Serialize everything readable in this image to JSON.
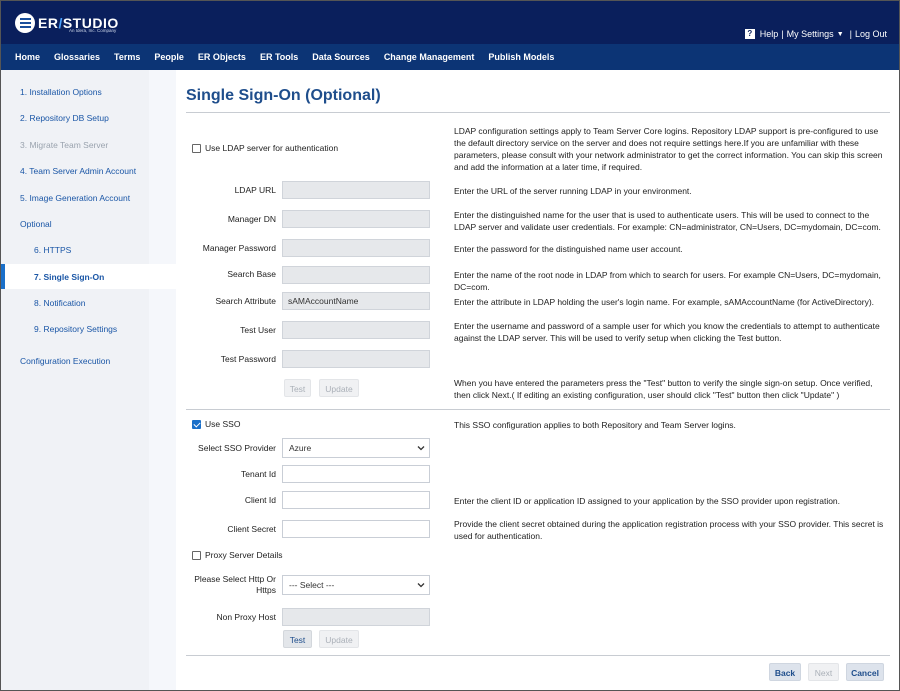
{
  "header": {
    "logo_text": "ER",
    "logo_text2": "STUDIO",
    "logo_sub": "An Idera, Inc. Company",
    "help_icon": "?",
    "help_label": "Help",
    "settings_label": "My Settings",
    "logout_label": "Log Out"
  },
  "nav": [
    "Home",
    "Glossaries",
    "Terms",
    "People",
    "ER Objects",
    "ER Tools",
    "Data Sources",
    "Change Management",
    "Publish Models"
  ],
  "sidebar": {
    "items": [
      {
        "label": "1. Installation Options"
      },
      {
        "label": "2. Repository DB Setup"
      },
      {
        "label": "3. Migrate Team Server"
      },
      {
        "label": "4. Team Server Admin Account"
      },
      {
        "label": "5. Image Generation Account"
      },
      {
        "label": "Optional"
      },
      {
        "label": "6. HTTPS"
      },
      {
        "label": "7. Single Sign-On"
      },
      {
        "label": "8. Notification"
      },
      {
        "label": "9. Repository Settings"
      },
      {
        "label": "Configuration Execution"
      }
    ]
  },
  "page": {
    "title": "Single Sign-On (Optional)"
  },
  "ldap": {
    "use_ldap_label": "Use LDAP server for authentication",
    "intro": "LDAP configuration settings apply to Team Server Core logins. Repository LDAP support is pre-configured to use the default directory service on the server and does not require settings here.If you are unfamiliar with these parameters, please consult with your network administrator to get the correct information. You can skip this screen and add the information at a later time, if required.",
    "fields": {
      "url": {
        "label": "LDAP URL",
        "value": "",
        "desc": "Enter the URL of the server running LDAP in your environment."
      },
      "manager_dn": {
        "label": "Manager DN",
        "value": "",
        "desc": "Enter the distinguished name for the user that is used to authenticate users. This will be used to connect to the LDAP server and validate user credentials. For example: CN=administrator, CN=Users, DC=mydomain, DC=com."
      },
      "manager_password": {
        "label": "Manager Password",
        "value": "",
        "desc": "Enter the password for the distinguished name user account."
      },
      "search_base": {
        "label": "Search Base",
        "value": "",
        "desc": "Enter the name of the root node in LDAP from which to search for users. For example CN=Users, DC=mydomain, DC=com."
      },
      "search_attribute": {
        "label": "Search Attribute",
        "value": "sAMAccountName",
        "desc": "Enter the attribute in LDAP holding the user's login name. For example, sAMAccountName (for ActiveDirectory)."
      },
      "test_user": {
        "label": "Test User",
        "value": "",
        "desc": "Enter the username and password of a sample user for which you know the credentials to attempt to authenticate against the LDAP server. This will be used to verify setup when clicking the Test button."
      },
      "test_password": {
        "label": "Test Password",
        "value": ""
      }
    },
    "test_label": "Test",
    "update_label": "Update",
    "verify_desc": "When you have entered the parameters press the \"Test\" button to verify the single sign-on setup. Once verified, then click Next.( If editing an existing configuration, user should click \"Test\" button then click \"Update\" )"
  },
  "sso": {
    "use_sso_label": "Use SSO",
    "intro": "This SSO configuration applies to both Repository and Team Server logins.",
    "provider_label": "Select SSO Provider",
    "provider_value": "Azure",
    "tenant_label": "Tenant Id",
    "tenant_value": "",
    "client_id_label": "Client Id",
    "client_id_value": "",
    "client_id_desc": "Enter the client ID or application ID assigned to your application by the SSO provider upon registration.",
    "client_secret_label": "Client Secret",
    "client_secret_value": "",
    "client_secret_desc": "Provide the client secret obtained during the application registration process with your SSO provider. This secret is used for authentication.",
    "proxy_label": "Proxy Server Details",
    "http_label": "Please Select Http Or Https",
    "http_value": "--- Select ---",
    "non_proxy_label": "Non Proxy Host",
    "non_proxy_value": "",
    "test_label": "Test",
    "update_label": "Update"
  },
  "footer": {
    "back_label": "Back",
    "next_label": "Next",
    "cancel_label": "Cancel"
  },
  "colors": {
    "header_bg": "#0a1f5c",
    "nav_bg": "#0c3475",
    "accent": "#1a6fc9",
    "title": "#1f4e8c"
  }
}
